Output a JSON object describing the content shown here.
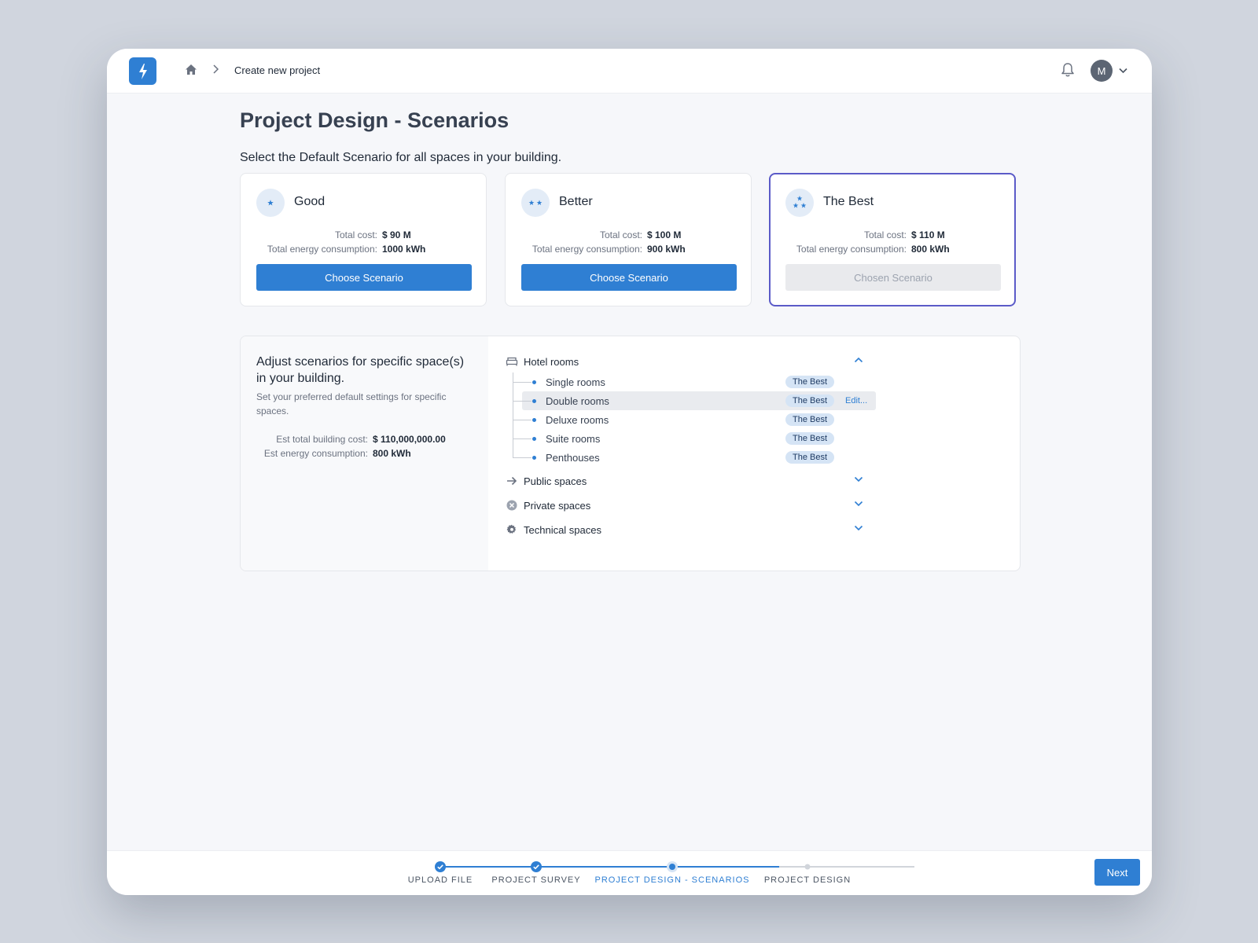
{
  "header": {
    "breadcrumb": "Create new project",
    "avatar_initial": "M"
  },
  "page": {
    "title": "Project Design - Scenarios",
    "subtitle": "Select the Default Scenario for all spaces in your building."
  },
  "scenarios": [
    {
      "name": "Good",
      "cost_label": "Total cost:",
      "cost": "$ 90 M",
      "energy_label": "Total energy consumption:",
      "energy": "1000 kWh",
      "button": "Choose Scenario",
      "stars": 1
    },
    {
      "name": "Better",
      "cost_label": "Total cost:",
      "cost": "$ 100 M",
      "energy_label": "Total energy consumption:",
      "energy": "900 kWh",
      "button": "Choose Scenario",
      "stars": 2
    },
    {
      "name": "The Best",
      "cost_label": "Total cost:",
      "cost": "$ 110 M",
      "energy_label": "Total energy consumption:",
      "energy": "800 kWh",
      "button": "Chosen Scenario",
      "stars": 3,
      "selected": true
    }
  ],
  "adjust": {
    "title": "Adjust scenarios for specific space(s) in your building.",
    "description": "Set your preferred default settings for specific spaces.",
    "cost_label": "Est total building cost:",
    "cost": "$ 110,000,000.00",
    "energy_label": "Est energy consumption:",
    "energy": "800 kWh"
  },
  "spaces": {
    "groups": [
      {
        "label": "Hotel rooms",
        "icon": "bed-icon",
        "expanded": true
      },
      {
        "label": "Public spaces",
        "icon": "arrow-right-icon",
        "expanded": false
      },
      {
        "label": "Private spaces",
        "icon": "x-circle-icon",
        "expanded": false
      },
      {
        "label": "Technical spaces",
        "icon": "gear-icon",
        "expanded": false
      }
    ],
    "hotel_rooms": [
      {
        "label": "Single rooms",
        "scenario": "The Best"
      },
      {
        "label": "Double rooms",
        "scenario": "The Best",
        "edit": "Edit..."
      },
      {
        "label": "Deluxe rooms",
        "scenario": "The Best"
      },
      {
        "label": "Suite rooms",
        "scenario": "The Best"
      },
      {
        "label": "Penthouses",
        "scenario": "The Best"
      }
    ]
  },
  "stepper": {
    "steps": [
      {
        "label": "UPLOAD FILE",
        "status": "done"
      },
      {
        "label": "PROJECT SURVEY",
        "status": "done"
      },
      {
        "label": "PROJECT DESIGN - SCENARIOS",
        "status": "active"
      },
      {
        "label": "PROJECT DESIGN",
        "status": "pending"
      }
    ],
    "next_label": "Next"
  },
  "colors": {
    "accent": "#2f7fd3",
    "selected_border": "#5b5bc8",
    "badge_bg": "#d5e4f5"
  }
}
